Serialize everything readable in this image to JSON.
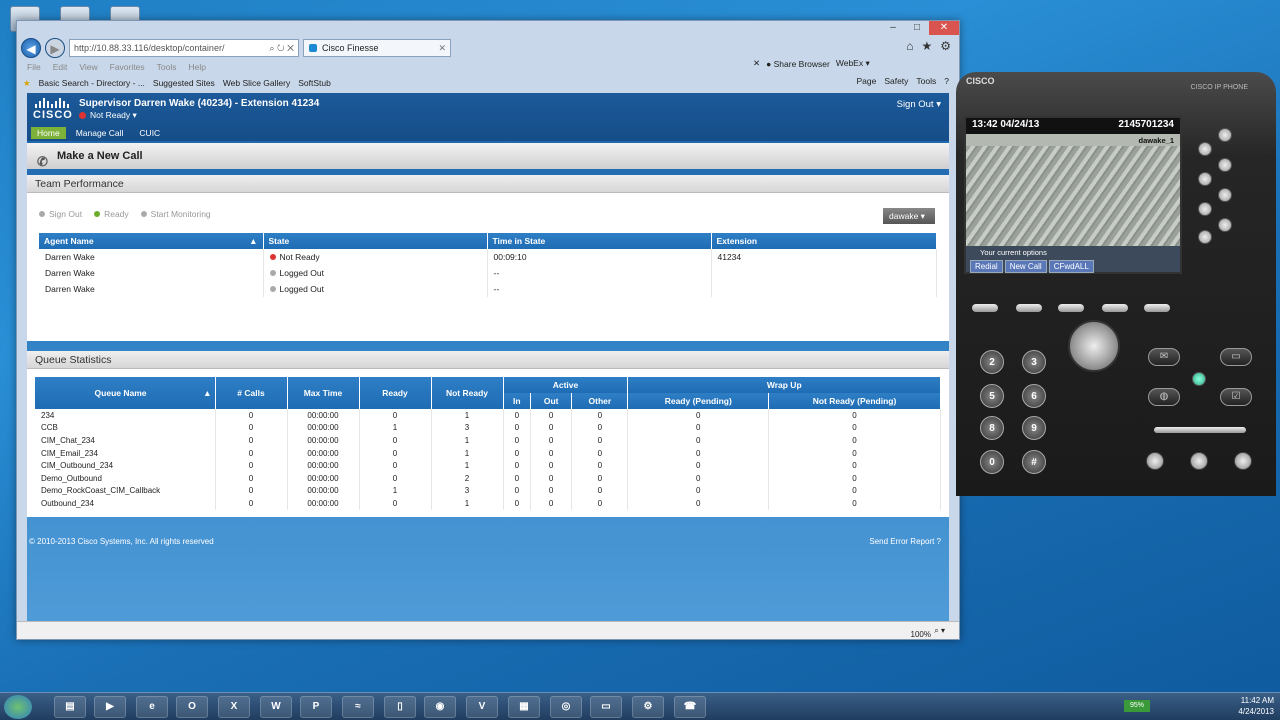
{
  "browser": {
    "url": "http://10.88.33.116/desktop/container/",
    "tab_title": "Cisco Finesse",
    "menu": [
      "File",
      "Edit",
      "View",
      "Favorites",
      "Tools",
      "Help"
    ],
    "share_browser": "Share Browser",
    "webex": "WebEx",
    "favorites": [
      "Basic Search - Directory - ...",
      "Suggested Sites",
      "Web Slice Gallery",
      "SoftStub"
    ],
    "commands": [
      "Page",
      "Safety",
      "Tools"
    ],
    "zoom": "100%"
  },
  "finesse": {
    "logo": "CISCO",
    "title": "Supervisor Darren Wake (40234) - Extension 41234",
    "state": "Not Ready",
    "sign_out": "Sign Out",
    "nav": [
      "Home",
      "Manage Call",
      "CUIC"
    ],
    "make_call": "Make a New Call",
    "team": {
      "title": "Team Performance",
      "buttons": [
        "Sign Out",
        "Ready",
        "Start Monitoring"
      ],
      "team_select": "dawake",
      "columns": [
        "Agent Name",
        "State",
        "Time in State",
        "Extension"
      ],
      "rows": [
        {
          "name": "Darren Wake",
          "state": "Not Ready",
          "time": "00:09:10",
          "ext": "41234"
        },
        {
          "name": "Darren Wake",
          "state": "Logged Out",
          "time": "--",
          "ext": ""
        },
        {
          "name": "Darren Wake",
          "state": "Logged Out",
          "time": "--",
          "ext": ""
        }
      ]
    },
    "queue": {
      "title": "Queue Statistics",
      "columns": [
        "Queue Name",
        "# Calls",
        "Max Time",
        "Ready",
        "Not Ready",
        "In",
        "Out",
        "Other",
        "Ready (Pending)",
        "Not Ready (Pending)"
      ],
      "group_active": "Active",
      "group_wrapup": "Wrap Up",
      "rows": [
        [
          "234",
          "0",
          "00:00:00",
          "0",
          "1",
          "0",
          "0",
          "0",
          "0",
          "0"
        ],
        [
          "CCB",
          "0",
          "00:00:00",
          "1",
          "3",
          "0",
          "0",
          "0",
          "0",
          "0"
        ],
        [
          "CIM_Chat_234",
          "0",
          "00:00:00",
          "0",
          "1",
          "0",
          "0",
          "0",
          "0",
          "0"
        ],
        [
          "CIM_Email_234",
          "0",
          "00:00:00",
          "0",
          "1",
          "0",
          "0",
          "0",
          "0",
          "0"
        ],
        [
          "CIM_Outbound_234",
          "0",
          "00:00:00",
          "0",
          "1",
          "0",
          "0",
          "0",
          "0",
          "0"
        ],
        [
          "Demo_Outbound",
          "0",
          "00:00:00",
          "0",
          "2",
          "0",
          "0",
          "0",
          "0",
          "0"
        ],
        [
          "Demo_RockCoast_CIM_Callback",
          "0",
          "00:00:00",
          "1",
          "3",
          "0",
          "0",
          "0",
          "0",
          "0"
        ],
        [
          "Outbound_234",
          "0",
          "00:00:00",
          "0",
          "1",
          "0",
          "0",
          "0",
          "0",
          "0"
        ]
      ]
    },
    "footer": "© 2010-2013 Cisco Systems, Inc. All rights reserved",
    "send_error": "Send Error Report"
  },
  "phone": {
    "brand": "CISCO",
    "model": "CISCO IP PHONE",
    "datetime": "13:42 04/24/13",
    "number": "2145701234",
    "line": "dawake_1",
    "options_label": "Your current options",
    "softkeys": [
      "Redial",
      "New Call",
      "CFwdALL"
    ],
    "keys": [
      "2",
      "3",
      "5",
      "6",
      "8",
      "9",
      "0",
      "#"
    ]
  },
  "taskbar": {
    "battery": "95%",
    "time": "11:42 AM",
    "date": "4/24/2013"
  }
}
